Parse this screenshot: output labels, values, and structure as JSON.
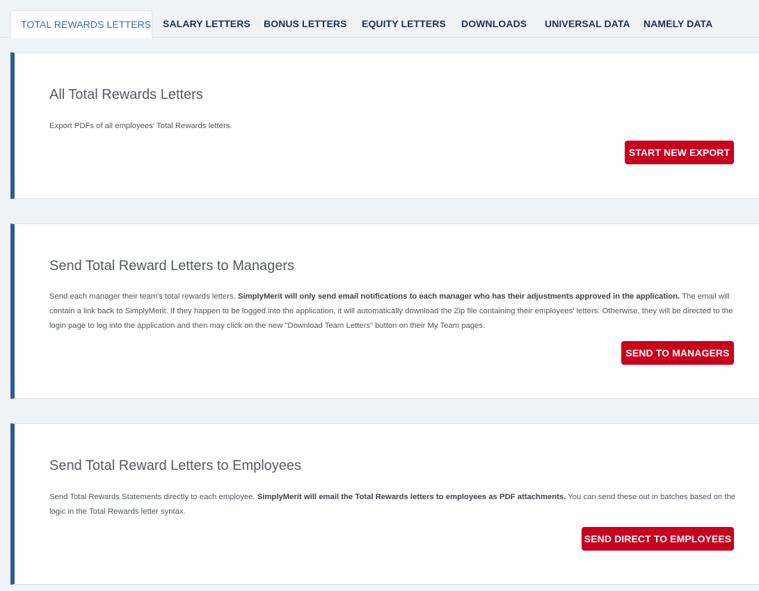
{
  "tabs": [
    {
      "label": "TOTAL REWARDS LETTERS",
      "active": true
    },
    {
      "label": "SALARY LETTERS"
    },
    {
      "label": "BONUS LETTERS"
    },
    {
      "label": "EQUITY LETTERS"
    },
    {
      "label": "DOWNLOADS"
    },
    {
      "label": "UNIVERSAL DATA"
    },
    {
      "label": "NAMELY DATA"
    }
  ],
  "cards": [
    {
      "title": "All Total Rewards Letters",
      "text": "Export PDFs of all employees' Total Rewards letters.",
      "button": "START NEW EXPORT"
    },
    {
      "title": "Send Total Reward Letters to Managers",
      "text_pre": "Send each manager their team's total rewards letters. ",
      "text_bold": "SimplyMerit will only send email notifications to each manager who has their adjustments approved in the application.",
      "text_post": " The email will contain a link back to SimplyMerit. If they happen to be logged into the application, it will automatically download the Zip file containing their employees' letters. Otherwise, they will be directed to the login page to log into the application and then may click on the new \"Download Team Letters\" button on their My Team pages.",
      "button": "SEND TO MANAGERS"
    },
    {
      "title": "Send Total Reward Letters to Employees",
      "text_pre": "Send Total Rewards Statements directly to each employee. ",
      "text_bold": "SimplyMerit will email the Total Rewards letters to employees as PDF attachments.",
      "text_post": " You can send these out in batches based on the logic in the Total Rewards letter syntax.",
      "button": "SEND DIRECT TO EMPLOYEES"
    }
  ],
  "colors": {
    "accent": "#2c5d94",
    "button": "#c8001e",
    "active_tab": "#2e6db4",
    "tab_text": "#1f2f55"
  }
}
